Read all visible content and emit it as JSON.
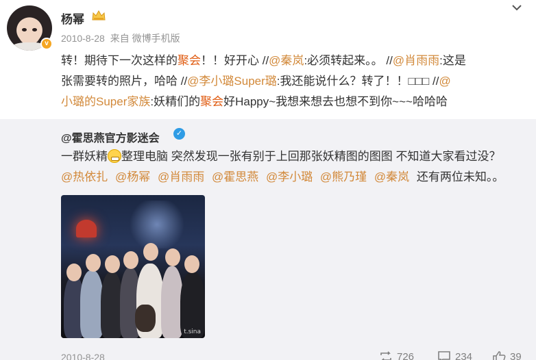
{
  "post": {
    "username": "杨幂",
    "date": "2010-8-28",
    "source": "来自 微博手机版",
    "text": {
      "line1": [
        {
          "t": "转！期待下一次这样的",
          "c": ""
        },
        {
          "t": "聚会",
          "c": "hl"
        },
        {
          "t": "！！好开心 //",
          "c": ""
        },
        {
          "t": "@秦岚",
          "c": "at"
        },
        {
          "t": ":必须转起来。。  //",
          "c": ""
        },
        {
          "t": "@肖雨雨",
          "c": "at"
        },
        {
          "t": ":这是",
          "c": ""
        }
      ],
      "line2": [
        {
          "t": "张需要转的照片，哈哈   //",
          "c": ""
        },
        {
          "t": "@李小璐Super璐",
          "c": "at"
        },
        {
          "t": ":我还能说什么？转了！！□□□   //",
          "c": ""
        },
        {
          "t": "@",
          "c": "at"
        }
      ],
      "line3": [
        {
          "t": "小璐的Super家族",
          "c": "at"
        },
        {
          "t": ":妖精们的",
          "c": ""
        },
        {
          "t": "聚会",
          "c": "hl"
        },
        {
          "t": "好Happy~我想来想去也想不到你~~~哈哈哈",
          "c": ""
        }
      ]
    }
  },
  "retweet": {
    "author": "@霍思燕官方影迷会",
    "text_line1_a": "一群妖精",
    "emoji": "grin-emoji",
    "text_line1_b": "整理电脑  突然发现一张有别于上回那张妖精图的图图 不知道大家看过没？",
    "mentions": [
      "@热依扎",
      "@杨幂",
      "@肖雨雨",
      "@霍思燕",
      "@李小璐",
      "@熊乃瑾",
      "@秦岚"
    ],
    "text_line2_tail": " 还有两位未知。。",
    "photo_caption": "t.sina",
    "date": "2010-8-28",
    "reposts": "726",
    "comments": "234",
    "likes": "39"
  },
  "colors": {
    "mention": "#d2893a",
    "highlight": "#e05c12",
    "retweet_bg": "#f2f2f5",
    "meta": "#939393"
  }
}
